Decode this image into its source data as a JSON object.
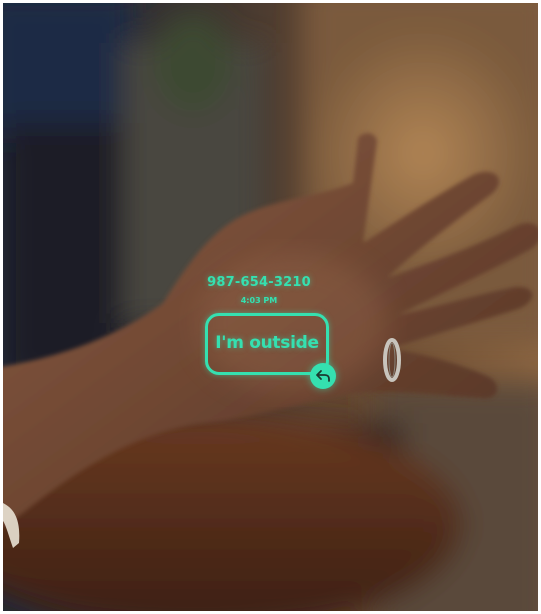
{
  "projection": {
    "phone_number": "987-654-3210",
    "time": "4:03 PM",
    "message": "I'm outside",
    "reply_icon": "reply-arrow-icon"
  },
  "colors": {
    "projection_accent": "#35e0b0"
  }
}
